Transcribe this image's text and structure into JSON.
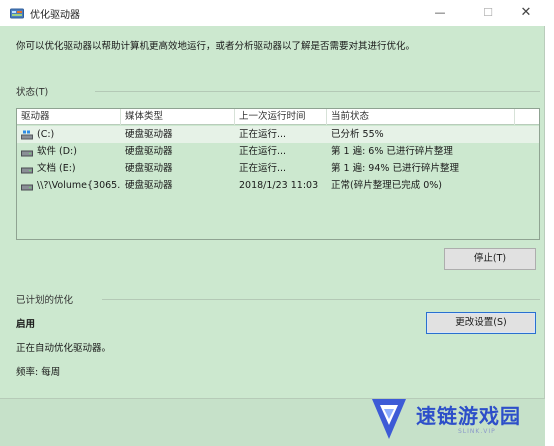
{
  "window": {
    "title": "优化驱动器",
    "controls": {
      "minimize": "—",
      "maximize": "☐",
      "close": "✕"
    }
  },
  "description": "你可以优化驱动器以帮助计算机更高效地运行，或者分析驱动器以了解是否需要对其进行优化。",
  "status_section": {
    "label": "状态(T)",
    "columns": [
      "驱动器",
      "媒体类型",
      "上一次运行时间",
      "当前状态"
    ],
    "rows": [
      {
        "drive": "(C:)",
        "media": "硬盘驱动器",
        "last_run": "正在运行...",
        "status": "已分析 55%",
        "icon": "windows-drive-icon",
        "selected": true
      },
      {
        "drive": "软件 (D:)",
        "media": "硬盘驱动器",
        "last_run": "正在运行...",
        "status": "第 1 遍: 6% 已进行碎片整理",
        "icon": "drive-icon"
      },
      {
        "drive": "文档 (E:)",
        "media": "硬盘驱动器",
        "last_run": "正在运行...",
        "status": "第 1 遍: 94% 已进行碎片整理",
        "icon": "drive-icon"
      },
      {
        "drive": "\\\\?\\Volume{3065...",
        "media": "硬盘驱动器",
        "last_run": "2018/1/23 11:03",
        "status": "正常(碎片整理已完成 0%)",
        "icon": "drive-icon"
      }
    ],
    "stop_button": "停止(T)"
  },
  "scheduled": {
    "label": "已计划的优化",
    "state": "启用",
    "detail": "正在自动优化驱动器。",
    "frequency": "频率: 每周",
    "change_button": "更改设置(S)"
  },
  "watermark": {
    "name": "速链游戏园",
    "sub": "SLINK.VIP"
  }
}
